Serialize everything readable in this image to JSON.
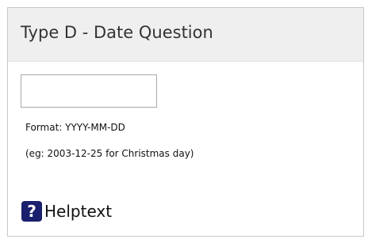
{
  "question": {
    "title": "Type D - Date Question",
    "input_value": "",
    "format_hint": "Format: YYYY-MM-DD",
    "example_hint": "(eg: 2003-12-25 for Christmas day)"
  },
  "help": {
    "icon_name": "help-question-icon",
    "icon_glyph": "?",
    "label": "Helptext",
    "icon_color": "#1a1f6e"
  }
}
